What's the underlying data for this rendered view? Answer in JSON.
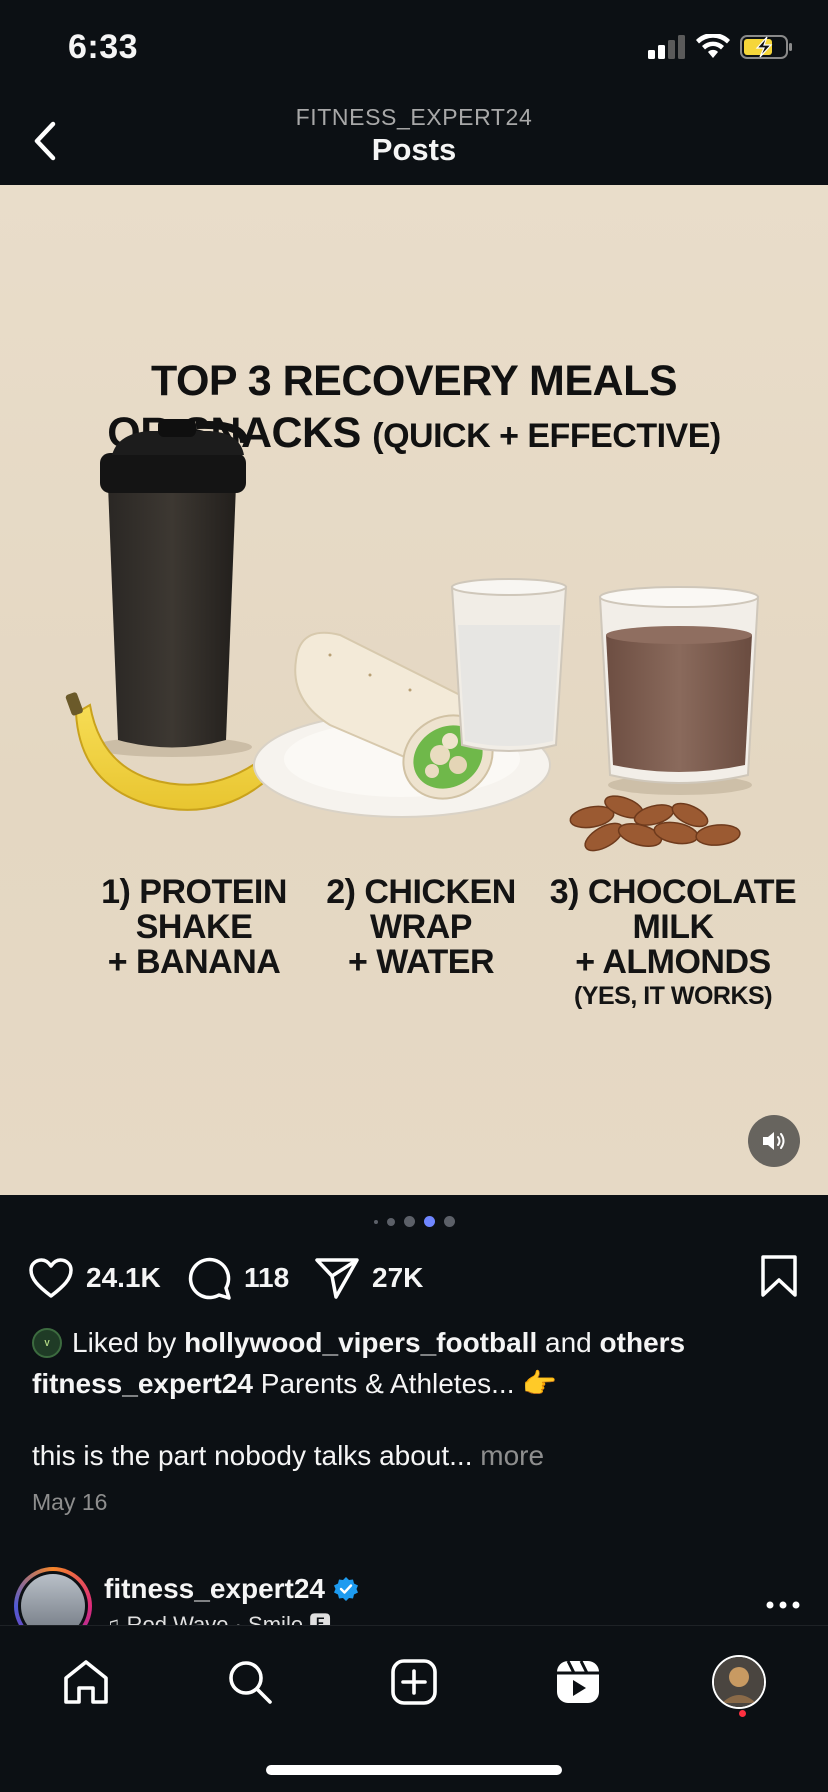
{
  "status_bar": {
    "time": "6:33"
  },
  "header": {
    "username": "FITNESS_EXPERT24",
    "title": "Posts"
  },
  "post_image": {
    "title_line1": "TOP 3 RECOVERY MEALS",
    "title_line2_main": "OR SNACKS",
    "title_line2_small": "(QUICK + EFFECTIVE)",
    "items": [
      {
        "line1": "1) PROTEIN",
        "line2": "SHAKE",
        "line3": "+ BANANA",
        "note": ""
      },
      {
        "line1": "2) CHICKEN",
        "line2": "WRAP",
        "line3": "+ WATER",
        "note": ""
      },
      {
        "line1": "3) CHOCOLATE",
        "line2": "MILK",
        "line3": "+ ALMONDS",
        "note": "(YES, IT WORKS)"
      }
    ]
  },
  "carousel": {
    "count": 5,
    "active_index": 3
  },
  "actions": {
    "likes": "24.1K",
    "comments": "118",
    "shares": "27K"
  },
  "liked_by": {
    "prefix": "Liked by",
    "user": "hollywood_vipers_football",
    "and": "and",
    "others": "others"
  },
  "caption": {
    "user": "fitness_expert24",
    "text": "Parents & Athletes... 👉"
  },
  "sub_caption": {
    "text": "this is the part nobody talks about...",
    "more": "more"
  },
  "date": "May 16",
  "next_post": {
    "username": "fitness_expert24",
    "song": "♫ Rod Wave · Smile 🅴"
  },
  "colors": {
    "background": "#0c1014",
    "image_bg": "#e8dcc8",
    "verified": "#1d9bf0",
    "active_dot": "#6f86ff",
    "notification": "#ff3040"
  }
}
